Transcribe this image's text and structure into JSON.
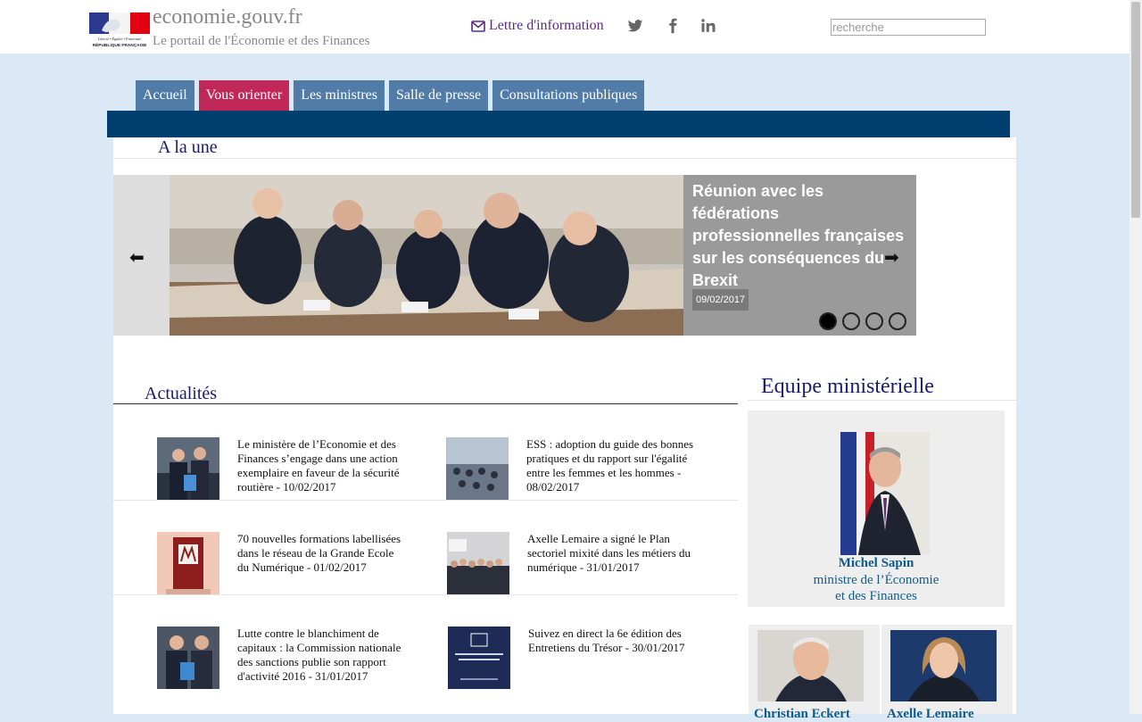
{
  "header": {
    "logo_text": "Liberté • Égalité • Fraternité RÉPUBLIQUE FRANÇAISE",
    "site_title": "economie.gouv.fr",
    "site_subtitle": "Le portail de l'Économie et des Finances",
    "newsletter_label": "Lettre d'information",
    "social_icons": [
      "twitter-icon",
      "facebook-icon",
      "linkedin-icon"
    ],
    "search_placeholder": "recherche"
  },
  "nav": {
    "tabs": [
      {
        "label": "Accueil",
        "active": false
      },
      {
        "label": "Vous orienter",
        "active": true
      },
      {
        "label": "Les ministres",
        "active": false
      },
      {
        "label": "Salle de presse",
        "active": false
      },
      {
        "label": "Consultations publiques",
        "active": false
      }
    ]
  },
  "une": {
    "title": "A la une",
    "slide": {
      "headline": "Réunion avec les fédérations professionnelles françaises sur les conséquences du Brexit",
      "date": "09/02/2017"
    },
    "dots": 4,
    "active_dot": 0
  },
  "actualites": {
    "title": "Actualités",
    "items": [
      {
        "text": "Le ministère de l’Economie et des Finances s’engage dans une action exemplaire en faveur de la sécurité routière - 10/02/2017"
      },
      {
        "text": "ESS : adoption du guide des bonnes pratiques et du rapport sur l'égalité entre les femmes et les hommes - 08/02/2017"
      },
      {
        "text": "70 nouvelles formations labellisées dans le réseau de la Grande Ecole du Numérique - 01/02/2017"
      },
      {
        "text": "Axelle Lemaire a signé le Plan sectoriel mixité dans les métiers du numérique - 31/01/2017"
      },
      {
        "text": "Lutte contre le blanchiment de capitaux : la Commission nationale des sanctions publie son rapport d'activité 2016 - 31/01/2017"
      },
      {
        "text": "Suivez en direct la 6e édition des Entretiens du Trésor - 30/01/2017"
      }
    ]
  },
  "equipe": {
    "title": "Equipe ministérielle",
    "main": {
      "name": "Michel Sapin",
      "role_line1": "ministre de l’Économie",
      "role_line2": "et des Finances"
    },
    "others": [
      {
        "name": "Christian Eckert"
      },
      {
        "name": "Axelle Lemaire"
      }
    ]
  },
  "colors": {
    "nav_tab": "#517ca8",
    "nav_active": "#c0285a",
    "nav_band": "#003f6e",
    "page_bg": "#dbe8f5",
    "title_color": "#1a1a6e",
    "minister_link": "#0f5c8c"
  }
}
